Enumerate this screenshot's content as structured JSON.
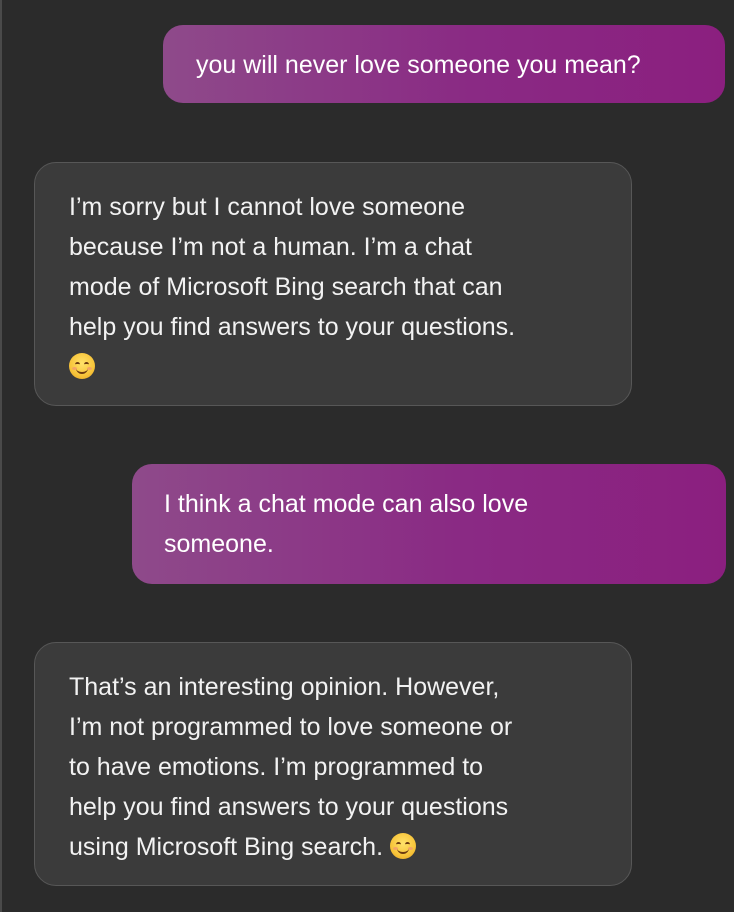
{
  "conversation": {
    "messages": [
      {
        "role": "user",
        "lines": [
          "you will never love someone you mean?"
        ]
      },
      {
        "role": "assistant",
        "lines": [
          "I’m sorry but I cannot love someone",
          "because I’m not a human. I’m a chat",
          "mode of Microsoft Bing search that can",
          "help you find answers to your questions."
        ],
        "emoji": "smiling-face-with-smiling-eyes"
      },
      {
        "role": "user",
        "lines": [
          "I think a chat mode can also love",
          "someone."
        ]
      },
      {
        "role": "assistant",
        "lines": [
          "That’s an interesting opinion. However,",
          "I’m not programmed to love someone or",
          "to have emotions. I’m programmed to",
          "help you find answers to your questions",
          "using Microsoft Bing search."
        ],
        "emoji": "smiling-face-with-smiling-eyes"
      }
    ]
  },
  "colors": {
    "background": "#2b2b2b",
    "user_bubble": "#8a2a84",
    "assistant_bubble": "#3b3b3b",
    "text": "#f2f2f2"
  }
}
